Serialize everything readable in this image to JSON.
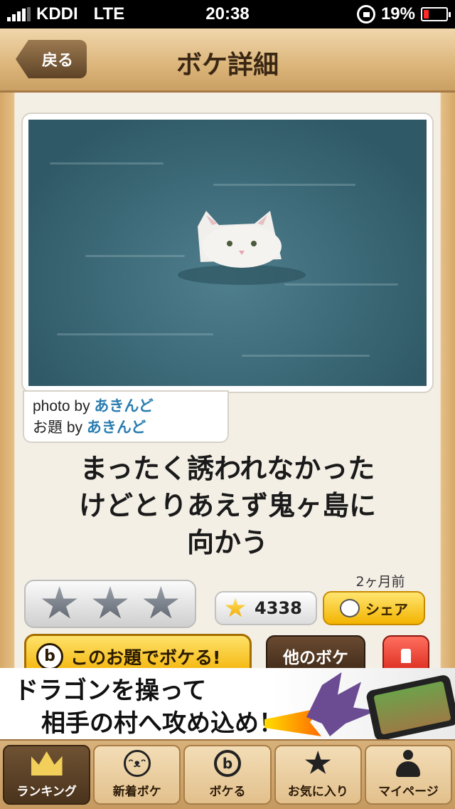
{
  "status_bar": {
    "carrier": "KDDI",
    "network": "LTE",
    "time": "20:38",
    "battery": "19%",
    "battery_level": 0.19,
    "signal_bars": 4
  },
  "nav": {
    "back_label": "戻る",
    "title": "ボケ詳細"
  },
  "post": {
    "photo_by_prefix": "photo by ",
    "photo_by_user": "あきんど",
    "theme_by_prefix": "お題 by ",
    "theme_by_user": "あきんど",
    "caption": "まったく誘われなかったけどとりあえず鬼ヶ島に向かう",
    "caption_lines": [
      "まったく誘われなかった",
      "けどとりあえず鬼ヶ島に",
      "向かう"
    ],
    "time_ago": "2ヶ月前",
    "star_count": "4338",
    "share_label": "シェア",
    "rating_stars": 3
  },
  "actions": {
    "boke_this_theme": "このお題でボケる!",
    "other_boke": "他のボケ"
  },
  "ad": {
    "line1": "ドラゴンを操って",
    "line2": "相手の村へ攻め込め！"
  },
  "tabs": [
    {
      "label": "ランキング",
      "icon": "crown-icon",
      "active": true
    },
    {
      "label": "新着ボケ",
      "icon": "face-icon",
      "active": false
    },
    {
      "label": "ボケる",
      "icon": "boke-b-icon",
      "active": false
    },
    {
      "label": "お気に入り",
      "icon": "star-icon",
      "active": false
    },
    {
      "label": "マイページ",
      "icon": "person-icon",
      "active": false
    }
  ],
  "colors": {
    "accent_yellow": "#f3b400",
    "link_blue": "#2a7db0",
    "wood": "#d6a868"
  }
}
